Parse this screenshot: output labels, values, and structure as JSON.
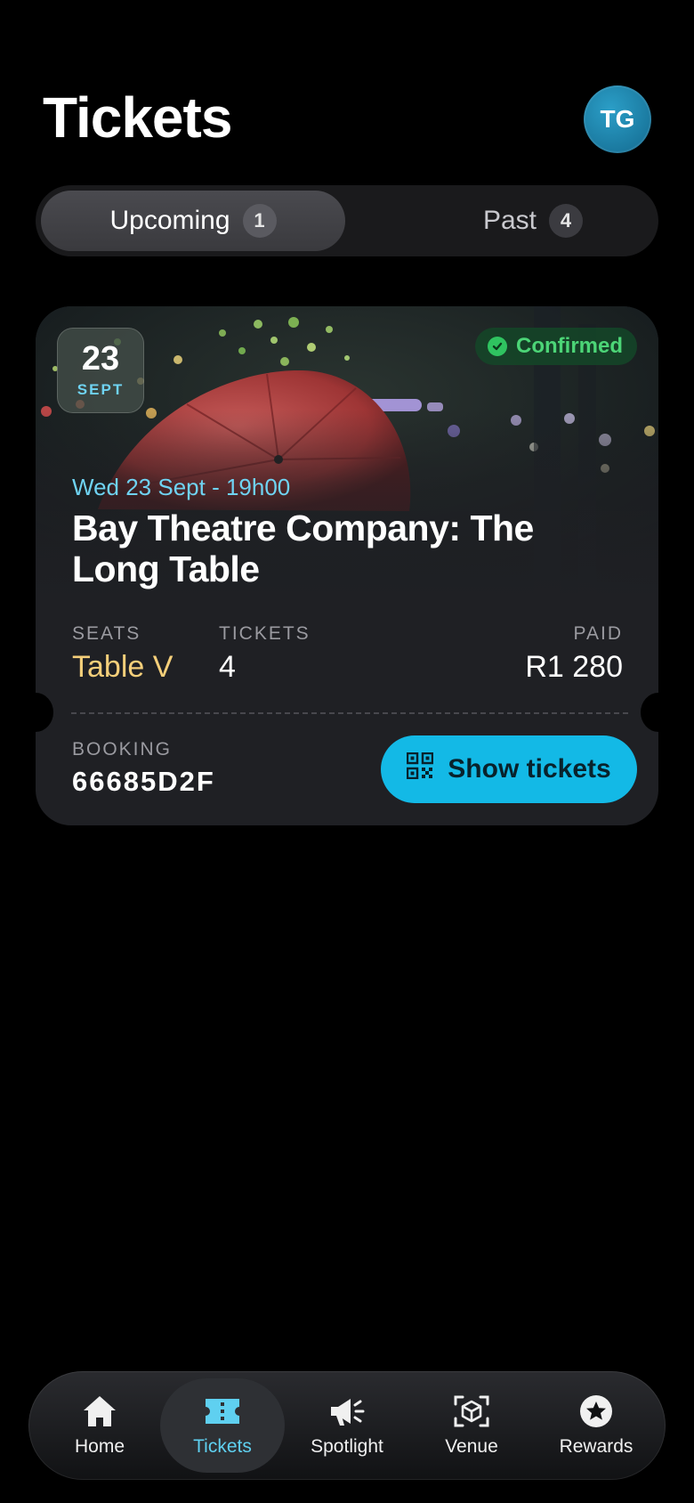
{
  "header": {
    "title": "Tickets",
    "avatar_initials": "TG"
  },
  "segments": [
    {
      "label": "Upcoming",
      "count": "1",
      "active": true
    },
    {
      "label": "Past",
      "count": "4",
      "active": false
    }
  ],
  "ticket": {
    "date_day": "23",
    "date_month": "SEPT",
    "status": "Confirmed",
    "event_when": "Wed 23 Sept - 19h00",
    "event_title": "Bay Theatre Company: The Long Table",
    "seats_label": "SEATS",
    "seats_value": "Table V",
    "tickets_label": "TICKETS",
    "tickets_value": "4",
    "paid_label": "PAID",
    "paid_value": "R1 280",
    "booking_label": "BOOKING",
    "booking_value": "66685D2F",
    "show_button": "Show tickets"
  },
  "nav": [
    {
      "label": "Home",
      "icon": "home-icon"
    },
    {
      "label": "Tickets",
      "icon": "ticket-icon",
      "active": true
    },
    {
      "label": "Spotlight",
      "icon": "megaphone-icon"
    },
    {
      "label": "Venue",
      "icon": "cube-scan-icon"
    },
    {
      "label": "Rewards",
      "icon": "star-badge-icon"
    }
  ],
  "colors": {
    "accent": "#13b9e6",
    "accent_text": "#6fd3f2",
    "confirmed": "#4cd577",
    "seats_value": "#f5cf7a",
    "background": "#000000",
    "card": "#1f2024"
  }
}
